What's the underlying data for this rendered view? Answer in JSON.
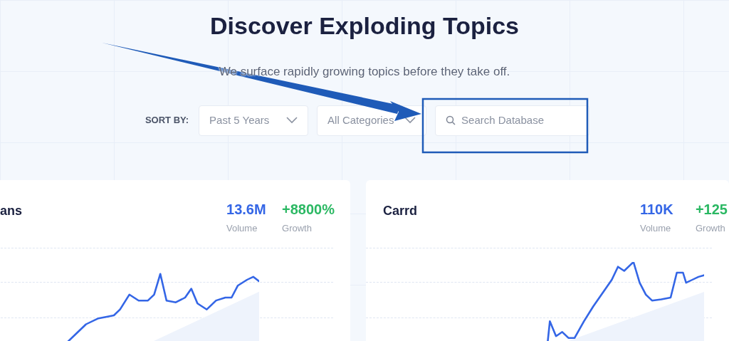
{
  "header": {
    "title": "Discover Exploding Topics",
    "subtitle": "We surface rapidly growing topics before they take off."
  },
  "sort": {
    "label": "SORT BY:",
    "timeframe": "Past 5 Years",
    "category": "All Categories",
    "search": {
      "placeholder": "Search Database"
    }
  },
  "cards": [
    {
      "title": "ans",
      "volume": "13.6M",
      "volume_label": "Volume",
      "growth": "+8800%",
      "growth_label": "Growth"
    },
    {
      "title": "Carrd",
      "volume": "110K",
      "volume_label": "Volume",
      "growth": "+125",
      "growth_label": "Growth"
    }
  ]
}
